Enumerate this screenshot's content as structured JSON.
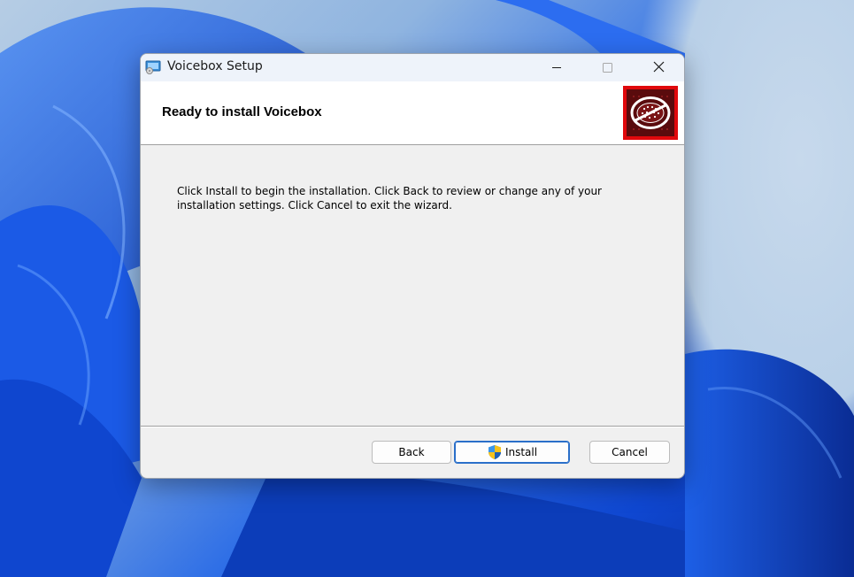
{
  "window": {
    "title": "Voicebox Setup",
    "app_icon": "installer-icon",
    "controls": {
      "minimize": "minimize-icon",
      "maximize": "maximize-icon",
      "close": "close-icon"
    }
  },
  "banner": {
    "title": "Ready to install Voicebox",
    "logo": "voicebox-logo-icon"
  },
  "body": {
    "text": "Click Install to begin the installation. Click Back to review or change any of your installation settings. Click Cancel to exit the wizard."
  },
  "footer": {
    "back_label": "Back",
    "install_label": "Install",
    "install_icon": "uac-shield-icon",
    "cancel_label": "Cancel"
  },
  "colors": {
    "logo_bg": "#e0080c",
    "primary_border": "#2a6fc9"
  }
}
